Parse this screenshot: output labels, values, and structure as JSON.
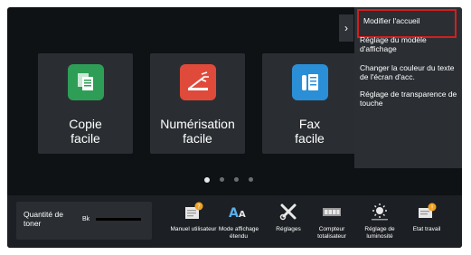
{
  "tiles": [
    {
      "label_line1": "Copie",
      "label_line2": "facile",
      "icon": "copy-icon",
      "color": "#2e9e56"
    },
    {
      "label_line1": "Numérisation",
      "label_line2": "facile",
      "icon": "scan-icon",
      "color": "#e04a3a"
    },
    {
      "label_line1": "Fax",
      "label_line2": "facile",
      "icon": "fax-icon",
      "color": "#2a8fd6"
    }
  ],
  "pagination": {
    "count": 4,
    "active_index": 0
  },
  "toner": {
    "label": "Quantité de toner",
    "color_label": "Bk"
  },
  "bottom_items": [
    {
      "label": "Manuel utilisateur",
      "icon": "manual-icon"
    },
    {
      "label": "Mode affichage étendu",
      "icon": "text-size-icon"
    },
    {
      "label": "Réglages",
      "icon": "settings-tools-icon"
    },
    {
      "label": "Compteur totalisateur",
      "icon": "counter-icon"
    },
    {
      "label": "Réglage de luminosité",
      "icon": "brightness-icon"
    },
    {
      "label": "Etat travail",
      "icon": "job-status-icon"
    }
  ],
  "menu": {
    "items": [
      "Modifier l'accueil",
      "Réglage du modèle d'affichage",
      "Changer la couleur du texte de l'écran d'acc.",
      "Réglage de transparence de touche"
    ]
  },
  "colors": {
    "highlight_border": "#d21f1f",
    "screen_bg": "#0f1215",
    "tile_bg": "#2a2e33"
  }
}
